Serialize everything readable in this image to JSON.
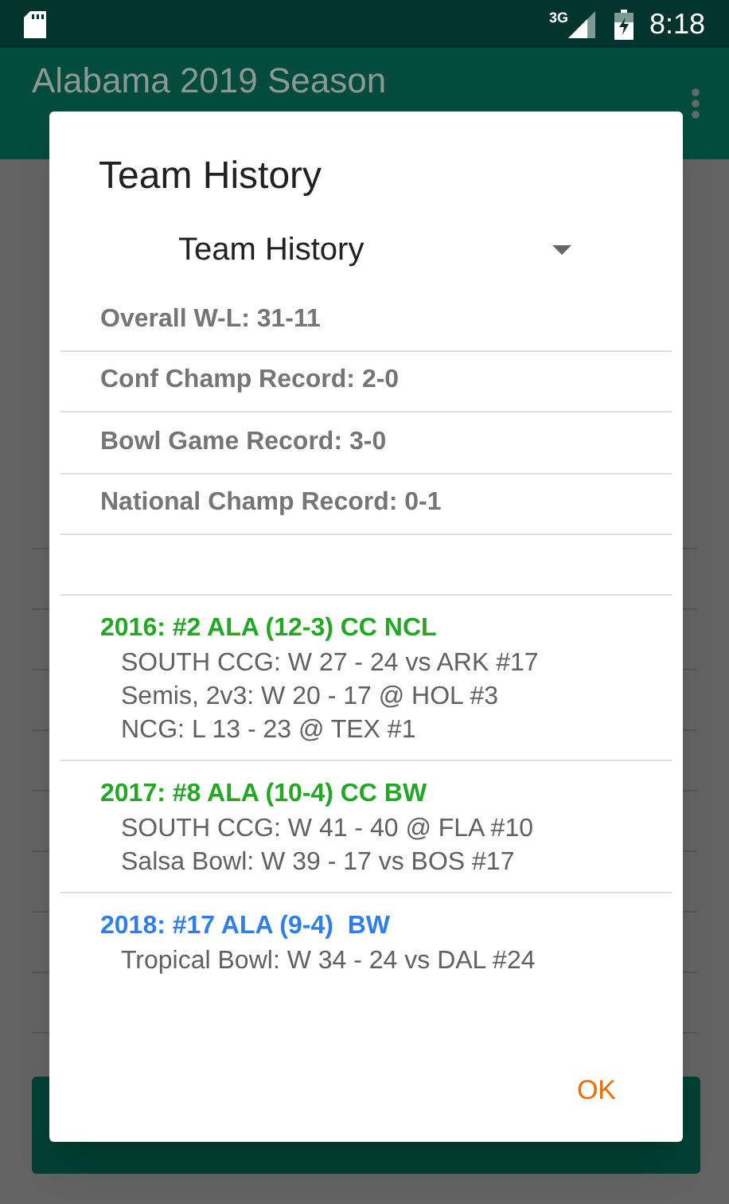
{
  "status_bar": {
    "time": "8:18",
    "network": "3G"
  },
  "app_bar": {
    "title": "Alabama 2019 Season"
  },
  "dialog": {
    "title": "Team History",
    "dropdown": {
      "value": "Team History"
    },
    "records": [
      "Overall W-L: 31-11",
      "Conf Champ Record: 2-0",
      "Bowl Game Record: 3-0",
      "National Champ Record: 0-1"
    ],
    "seasons": [
      {
        "heading": "2016: #2 ALA (12-3) CC NCL",
        "color": "#22a822",
        "games": [
          "SOUTH CCG: W 27 - 24 vs ARK #17",
          "Semis, 2v3: W 20 - 17 @ HOL #3",
          "NCG: L 13 - 23 @ TEX #1"
        ]
      },
      {
        "heading": "2017: #8 ALA (10-4) CC BW",
        "color": "#22a822",
        "games": [
          "SOUTH CCG: W 41 - 40 @ FLA #10",
          "Salsa Bowl: W 39 - 17 vs BOS #17"
        ]
      },
      {
        "heading": "2018: #17 ALA (9-4)  BW",
        "color": "#2d7ff0",
        "games": [
          "Tropical Bowl: W 34 - 24 vs DAL #24"
        ]
      }
    ],
    "button": "OK"
  }
}
